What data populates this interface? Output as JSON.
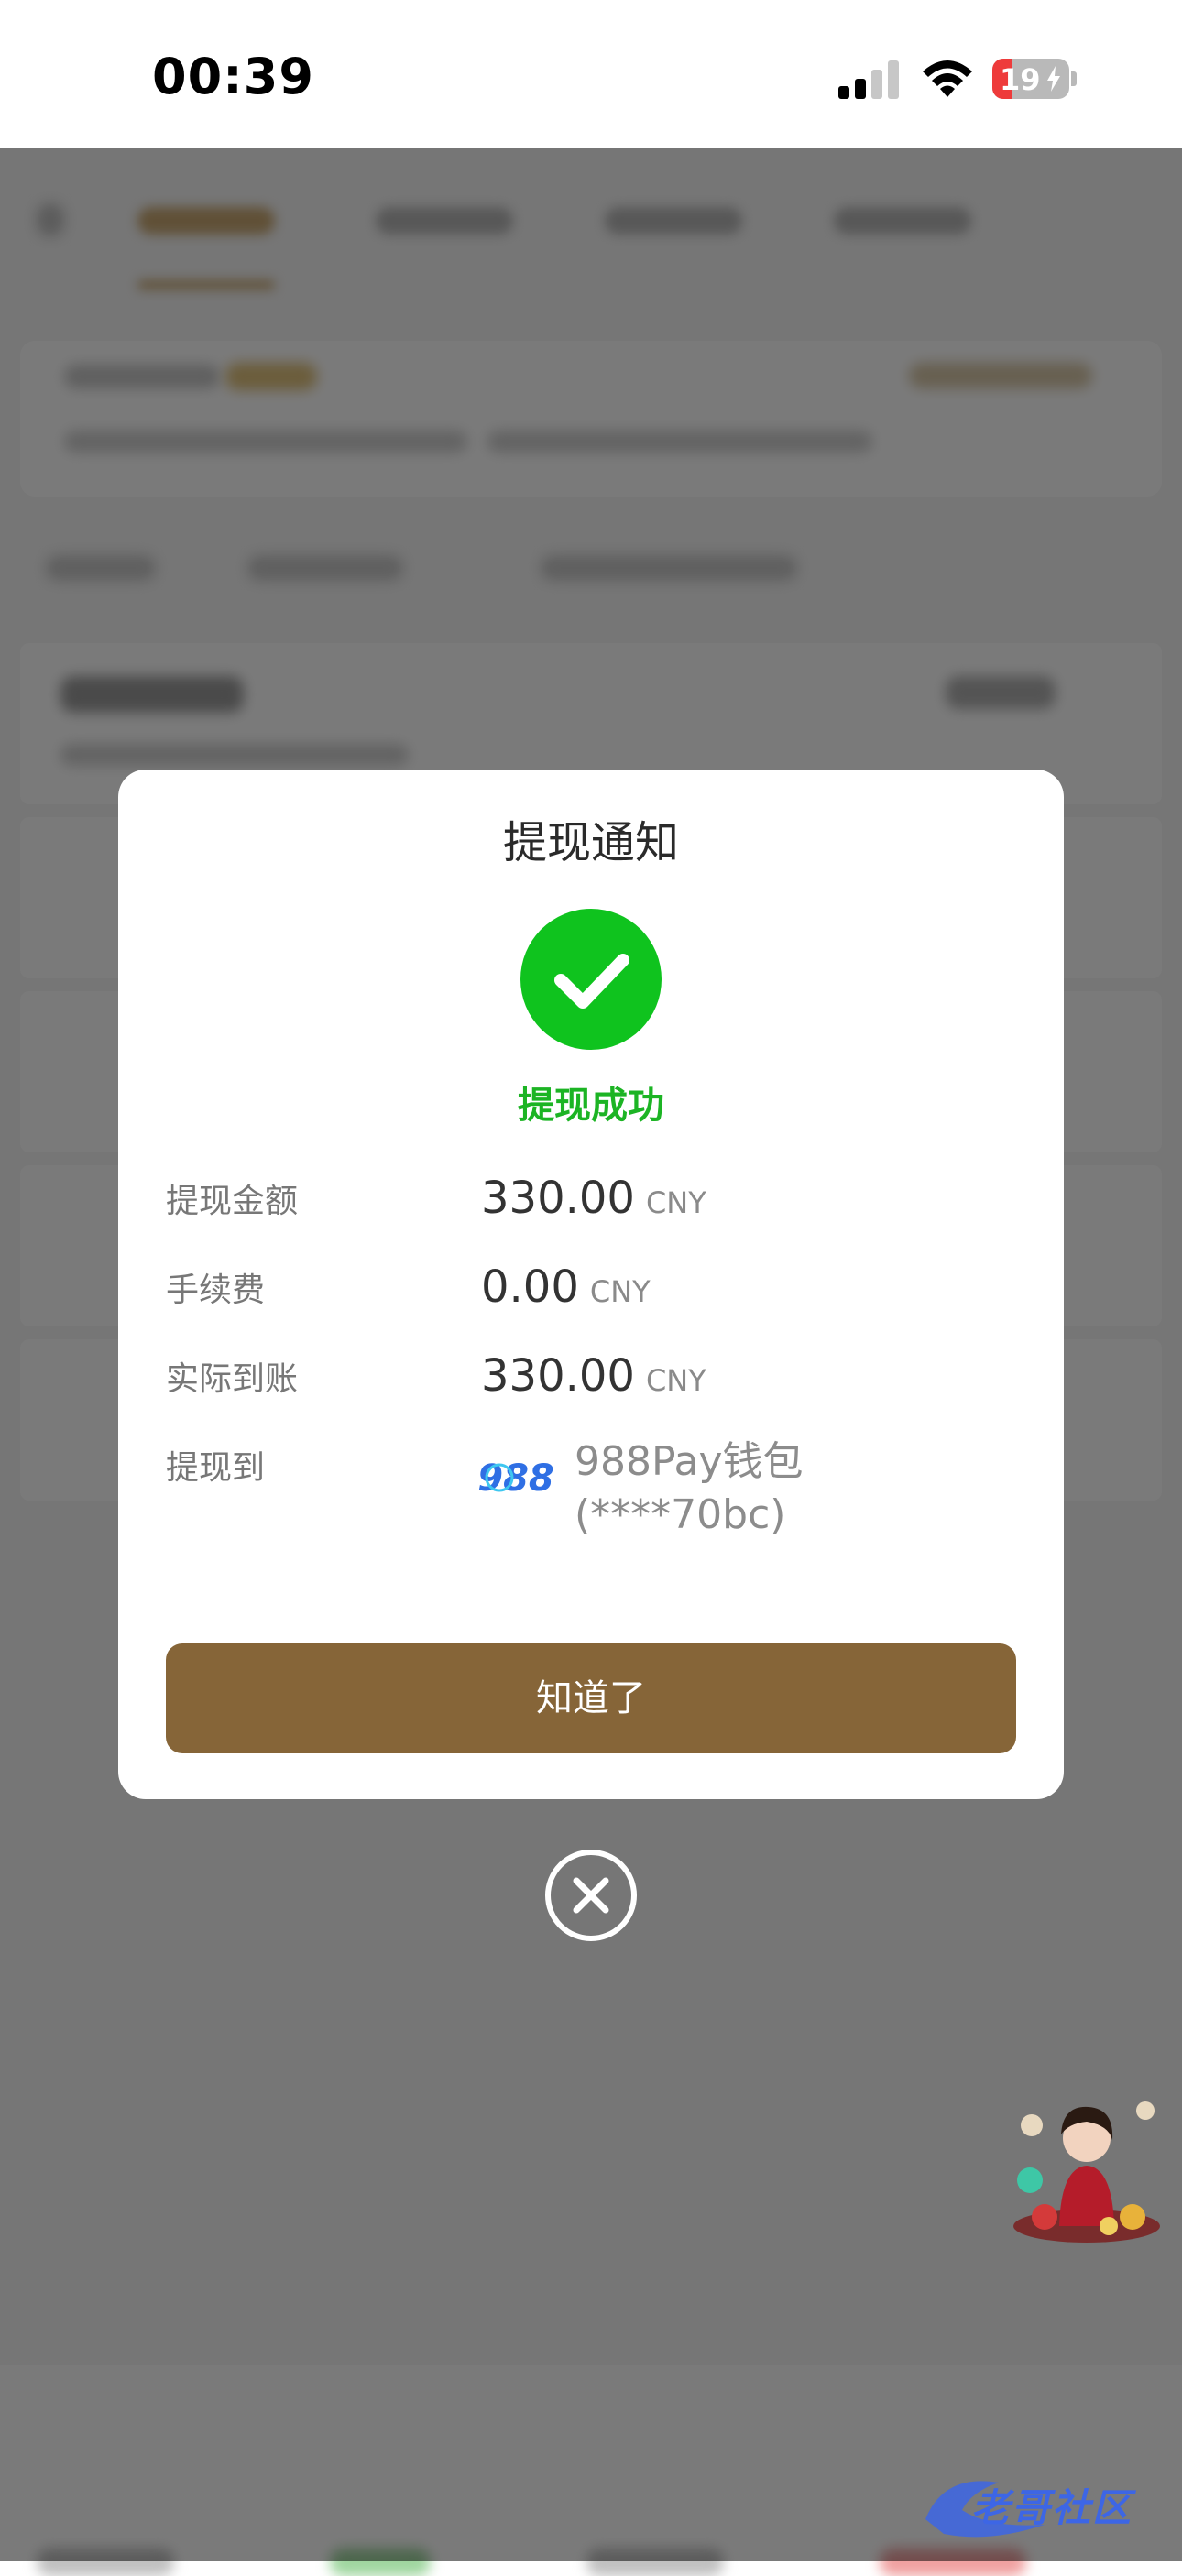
{
  "status_bar": {
    "time": "00:39",
    "battery_level": "19",
    "battery_fraction": 0.19,
    "signal_bars": 2
  },
  "dialog": {
    "title": "提现通知",
    "status_text": "提现成功",
    "rows": [
      {
        "label": "提现金额",
        "value": "330.00",
        "unit": "CNY"
      },
      {
        "label": "手续费",
        "value": "0.00",
        "unit": "CNY"
      },
      {
        "label": "实际到账",
        "value": "330.00",
        "unit": "CNY"
      }
    ],
    "destination": {
      "label": "提现到",
      "wallet_name": "988Pay钱包",
      "account": "(****70bc)",
      "logo_text": "988"
    },
    "confirm_label": "知道了"
  },
  "watermark": {
    "text": "老哥社区"
  },
  "colors": {
    "success": "#0fc31e",
    "button": "#866538",
    "overlay": "rgba(0,0,0,0.52)"
  }
}
